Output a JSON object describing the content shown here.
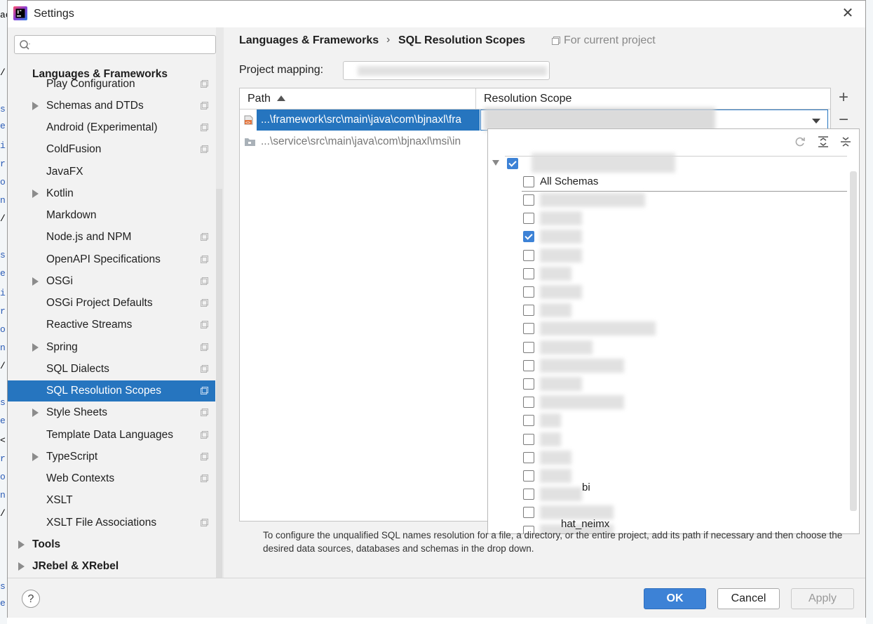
{
  "window": {
    "title": "Settings",
    "close_glyph": "✕"
  },
  "sidebar": {
    "search_placeholder": "",
    "items": [
      {
        "label": "Languages & Frameworks",
        "bold": true,
        "indent": 0
      },
      {
        "label": "Play Configuration",
        "indent": 1,
        "project": true
      },
      {
        "label": "Schemas and DTDs",
        "indent": 1,
        "arrow": true,
        "project": true
      },
      {
        "label": "Android (Experimental)",
        "indent": 1,
        "project": true
      },
      {
        "label": "ColdFusion",
        "indent": 1,
        "project": true
      },
      {
        "label": "JavaFX",
        "indent": 1
      },
      {
        "label": "Kotlin",
        "indent": 1,
        "arrow": true
      },
      {
        "label": "Markdown",
        "indent": 1
      },
      {
        "label": "Node.js and NPM",
        "indent": 1,
        "project": true
      },
      {
        "label": "OpenAPI Specifications",
        "indent": 1,
        "project": true
      },
      {
        "label": "OSGi",
        "indent": 1,
        "arrow": true,
        "project": true
      },
      {
        "label": "OSGi Project Defaults",
        "indent": 1,
        "project": true
      },
      {
        "label": "Reactive Streams",
        "indent": 1,
        "project": true
      },
      {
        "label": "Spring",
        "indent": 1,
        "arrow": true,
        "project": true
      },
      {
        "label": "SQL Dialects",
        "indent": 1,
        "project": true
      },
      {
        "label": "SQL Resolution Scopes",
        "indent": 1,
        "project": true,
        "selected": true
      },
      {
        "label": "Style Sheets",
        "indent": 1,
        "arrow": true,
        "project": true
      },
      {
        "label": "Template Data Languages",
        "indent": 1,
        "project": true
      },
      {
        "label": "TypeScript",
        "indent": 1,
        "arrow": true,
        "project": true
      },
      {
        "label": "Web Contexts",
        "indent": 1,
        "project": true
      },
      {
        "label": "XSLT",
        "indent": 1
      },
      {
        "label": "XSLT File Associations",
        "indent": 1,
        "project": true
      },
      {
        "label": "Tools",
        "bold": true,
        "indent": 0,
        "arrow": true
      },
      {
        "label": "JRebel & XRebel",
        "bold": true,
        "indent": 0,
        "arrow": true
      }
    ]
  },
  "content": {
    "breadcrumb": [
      "Languages & Frameworks",
      "SQL Resolution Scopes"
    ],
    "breadcrumb_sep": "›",
    "for_current_project": "For current project",
    "project_mapping_label": "Project mapping:",
    "table": {
      "columns": [
        "Path",
        "Resolution Scope"
      ],
      "rows": [
        {
          "path": "...\\framework\\src\\main\\java\\com\\bjnaxl\\fra",
          "selected": true
        },
        {
          "path": "...\\service\\src\\main\\java\\com\\bjnaxl\\msi\\in",
          "selected": false
        }
      ]
    },
    "add_glyph": "+",
    "remove_glyph": "−",
    "popup": {
      "all_schemas_label": "All Schemas",
      "partial_label": "hat_neimx",
      "partial_label_2": "bi",
      "checked_index": 2
    },
    "description": "To configure the unqualified SQL names resolution for a file, a directory, or the entire project, add its path if necessary and then choose the desired data sources, databases and schemas in the drop down."
  },
  "footer": {
    "help": "?",
    "ok": "OK",
    "cancel": "Cancel",
    "apply": "Apply"
  },
  "colors": {
    "accent": "#2675bf",
    "ok_button": "#3d82d6"
  }
}
